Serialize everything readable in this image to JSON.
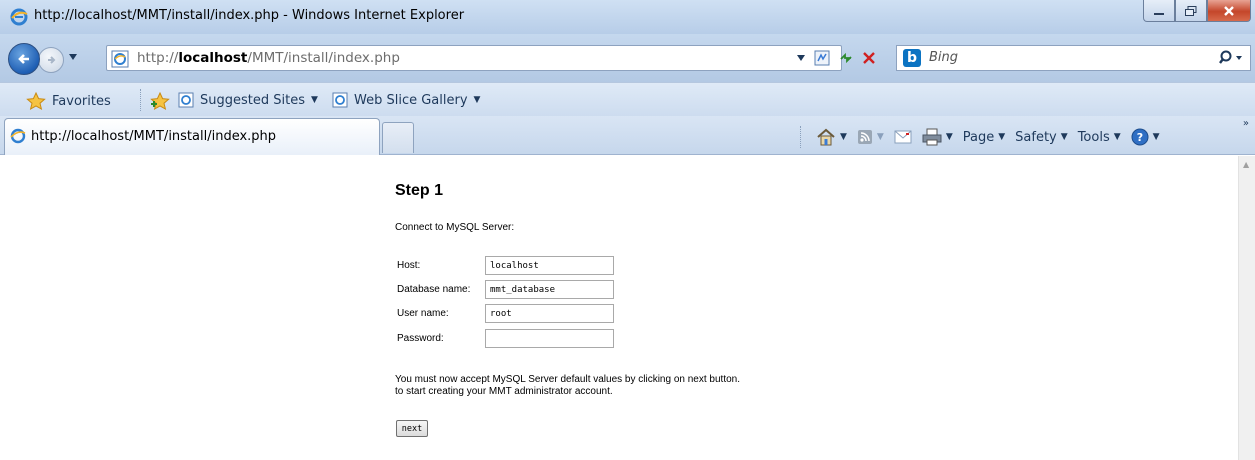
{
  "window": {
    "title": "http://localhost/MMT/install/index.php - Windows Internet Explorer"
  },
  "address_bar": {
    "url_prefix": "http://",
    "url_host": "localhost",
    "url_path": "/MMT/install/index.php",
    "search_placeholder": "Bing"
  },
  "favorites_bar": {
    "favorites_label": "Favorites",
    "items": [
      {
        "label": "Suggested Sites",
        "icon": "ie-page-icon"
      },
      {
        "label": "Web Slice Gallery",
        "icon": "ie-page-icon"
      }
    ]
  },
  "tabs": [
    {
      "label": "http://localhost/MMT/install/index.php",
      "active": true
    }
  ],
  "command_bar": {
    "page_label": "Page",
    "safety_label": "Safety",
    "tools_label": "Tools"
  },
  "page": {
    "heading": "Step 1",
    "intro": "Connect to MySQL Server:",
    "fields": [
      {
        "label": "Host:",
        "value": "localhost"
      },
      {
        "label": "Database name:",
        "value": "mmt_database"
      },
      {
        "label": "User name:",
        "value": "root"
      },
      {
        "label": "Password:",
        "value": ""
      }
    ],
    "note_line1": "You must now accept MySQL Server default values by clicking on next button.",
    "note_line2": "to start creating your MMT administrator account.",
    "next_label": "next"
  },
  "colors": {
    "chrome_blue": "#c5d8ee",
    "close_red": "#c4462a",
    "bing_blue": "#0b73c2"
  }
}
